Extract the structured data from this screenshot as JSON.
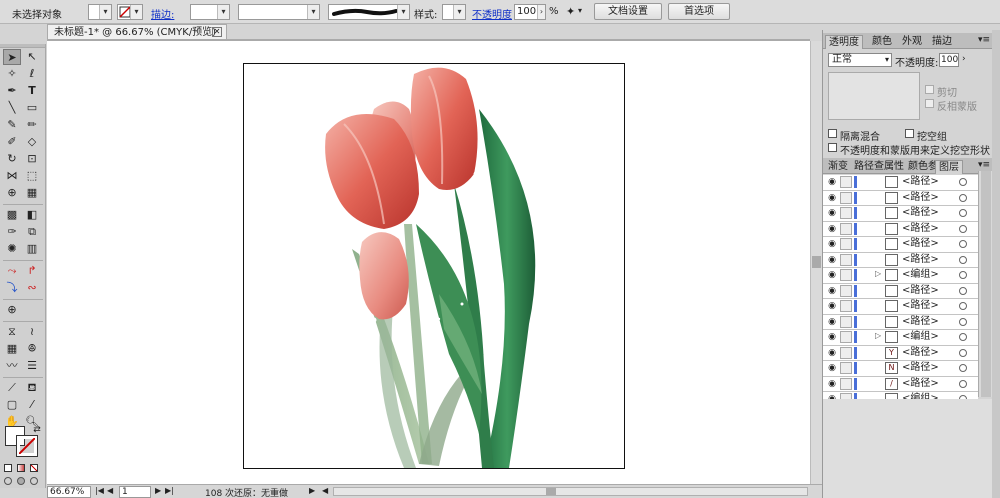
{
  "control_bar": {
    "selection_label": "未选择对象",
    "stroke_label": "描边:",
    "style_label": "样式:",
    "opacity_label": "不透明度",
    "opacity_value": "100",
    "opacity_unit": "%",
    "doc_setup_button": "文档设置",
    "prefs_button": "首选项"
  },
  "document": {
    "tab_title": "未标题-1* @ 66.67% (CMYK/预览)",
    "close_glyph": "✕"
  },
  "status_bar": {
    "zoom": "66.67%",
    "page": "1",
    "undo_info": "108 次还原：无重做"
  },
  "appearance_panel": {
    "tabs": [
      "透明度",
      "颜色",
      "外观",
      "描边"
    ],
    "blend_mode": "正常",
    "opacity_label": "不透明度:",
    "opacity_value": "100",
    "clip_label": "剪切",
    "invert_mask_label": "反相蒙版",
    "isolate_blend_label": "隔离混合",
    "knockout_group_label": "挖空组",
    "opacity_mask_label": "不透明度和蒙版用来定义挖空形状"
  },
  "layers_panel": {
    "tabs": [
      "渐变",
      "路径查",
      "属性",
      "颜色参",
      "图层"
    ],
    "rows": [
      {
        "name": "<路径>",
        "group": false,
        "thumb": ""
      },
      {
        "name": "<路径>",
        "group": false,
        "thumb": ""
      },
      {
        "name": "<路径>",
        "group": false,
        "thumb": ""
      },
      {
        "name": "<路径>",
        "group": false,
        "thumb": ""
      },
      {
        "name": "<路径>",
        "group": false,
        "thumb": ""
      },
      {
        "name": "<路径>",
        "group": false,
        "thumb": ""
      },
      {
        "name": "<编组>",
        "group": true,
        "thumb": ""
      },
      {
        "name": "<路径>",
        "group": false,
        "thumb": ""
      },
      {
        "name": "<路径>",
        "group": false,
        "thumb": ""
      },
      {
        "name": "<路径>",
        "group": false,
        "thumb": ""
      },
      {
        "name": "<编组>",
        "group": true,
        "thumb": ""
      },
      {
        "name": "<路径>",
        "group": false,
        "thumb": "Y"
      },
      {
        "name": "<路径>",
        "group": false,
        "thumb": "N"
      },
      {
        "name": "<路径>",
        "group": false,
        "thumb": "/"
      },
      {
        "name": "<编组>",
        "group": false,
        "thumb": ""
      }
    ]
  },
  "colors": {
    "link": "#1030c8",
    "layer_color": "#4a6fd8",
    "tulip_red": "#d9534a",
    "leaf_green": "#2f7d4a"
  }
}
